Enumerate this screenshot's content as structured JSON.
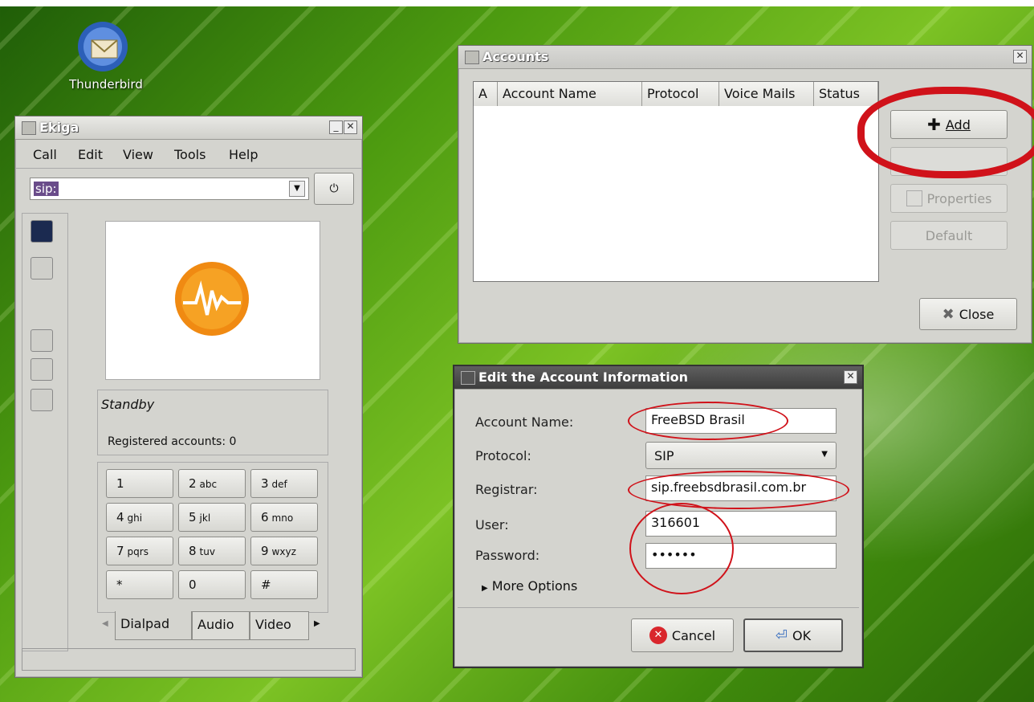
{
  "desktop": {
    "thunderbird_label": "Thunderbird"
  },
  "ekiga": {
    "title": "Ekiga",
    "menu": [
      "Call",
      "Edit",
      "View",
      "Tools",
      "Help"
    ],
    "address_value": "sip:",
    "status": "Standby",
    "registered": "Registered accounts: 0",
    "keys": [
      {
        "n": "1",
        "s": ""
      },
      {
        "n": "2",
        "s": "abc"
      },
      {
        "n": "3",
        "s": "def"
      },
      {
        "n": "4",
        "s": "ghi"
      },
      {
        "n": "5",
        "s": "jkl"
      },
      {
        "n": "6",
        "s": "mno"
      },
      {
        "n": "7",
        "s": "pqrs"
      },
      {
        "n": "8",
        "s": "tuv"
      },
      {
        "n": "9",
        "s": "wxyz"
      },
      {
        "n": "*",
        "s": ""
      },
      {
        "n": "0",
        "s": ""
      },
      {
        "n": "#",
        "s": ""
      }
    ],
    "tabs": [
      "Dialpad",
      "Audio",
      "Video"
    ]
  },
  "accounts": {
    "title": "Accounts",
    "columns": [
      "A",
      "Account Name",
      "Protocol",
      "Voice Mails",
      "Status"
    ],
    "add_label": "Add",
    "properties_label": "Properties",
    "default_label": "Default",
    "close_label": "Close"
  },
  "edit": {
    "title": "Edit the Account Information",
    "labels": {
      "account_name": "Account Name:",
      "protocol": "Protocol:",
      "registrar": "Registrar:",
      "user": "User:",
      "password": "Password:"
    },
    "values": {
      "account_name": "FreeBSD Brasil",
      "protocol": "SIP",
      "registrar": "sip.freebsdbrasil.com.br",
      "user": "316601",
      "password": "••••••"
    },
    "more_options": "More Options",
    "cancel_label": "Cancel",
    "ok_label": "OK"
  },
  "colors": {
    "annotation_red": "#d0121a",
    "title_dark": "#4a4a4a"
  }
}
